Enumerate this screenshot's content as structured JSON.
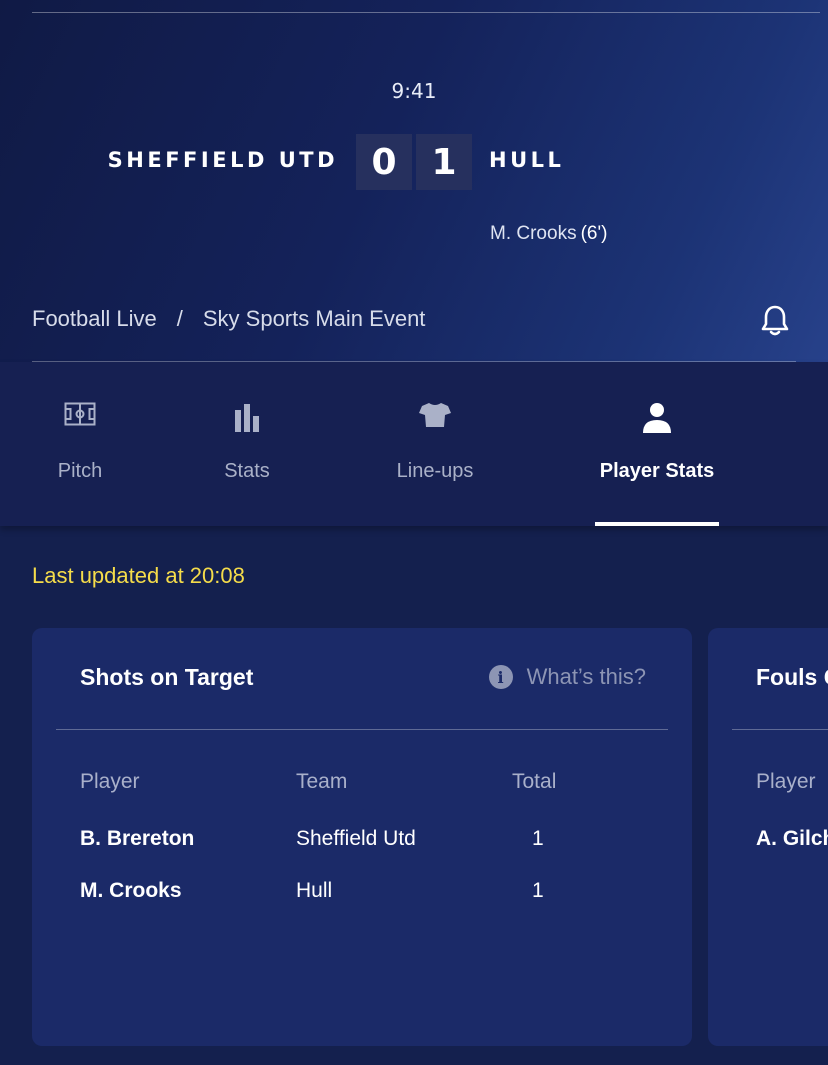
{
  "match": {
    "clock": "9:41",
    "home_team": "SHEFFIELD UTD",
    "away_team": "HULL",
    "home_score": "0",
    "away_score": "1",
    "scorer_name": "M. Crooks",
    "scorer_minute": "(6')"
  },
  "breadcrumb": {
    "section": "Football Live",
    "separator": "/",
    "channel": "Sky Sports Main Event"
  },
  "tabs": [
    {
      "label": "Pitch",
      "icon": "pitch-icon"
    },
    {
      "label": "Stats",
      "icon": "bar-chart-icon"
    },
    {
      "label": "Line-ups",
      "icon": "shirt-icon"
    },
    {
      "label": "Player Stats",
      "icon": "person-icon",
      "active": true
    }
  ],
  "last_updated": "Last updated at 20:08",
  "cards": [
    {
      "title": "Shots on Target",
      "help_label": "What’s this?",
      "columns": [
        "Player",
        "Team",
        "Total"
      ],
      "rows": [
        {
          "player": "B. Brereton",
          "team": "Sheffield Utd",
          "total": "1"
        },
        {
          "player": "M. Crooks",
          "team": "Hull",
          "total": "1"
        }
      ]
    },
    {
      "title": "Fouls C",
      "columns": [
        "Player"
      ],
      "rows": [
        {
          "player": "A. Gilch"
        }
      ]
    }
  ],
  "colors": {
    "background": "#14204e",
    "card": "#1b2a68",
    "highlight_yellow": "#f5dc4a",
    "score_box": "#26305e"
  }
}
